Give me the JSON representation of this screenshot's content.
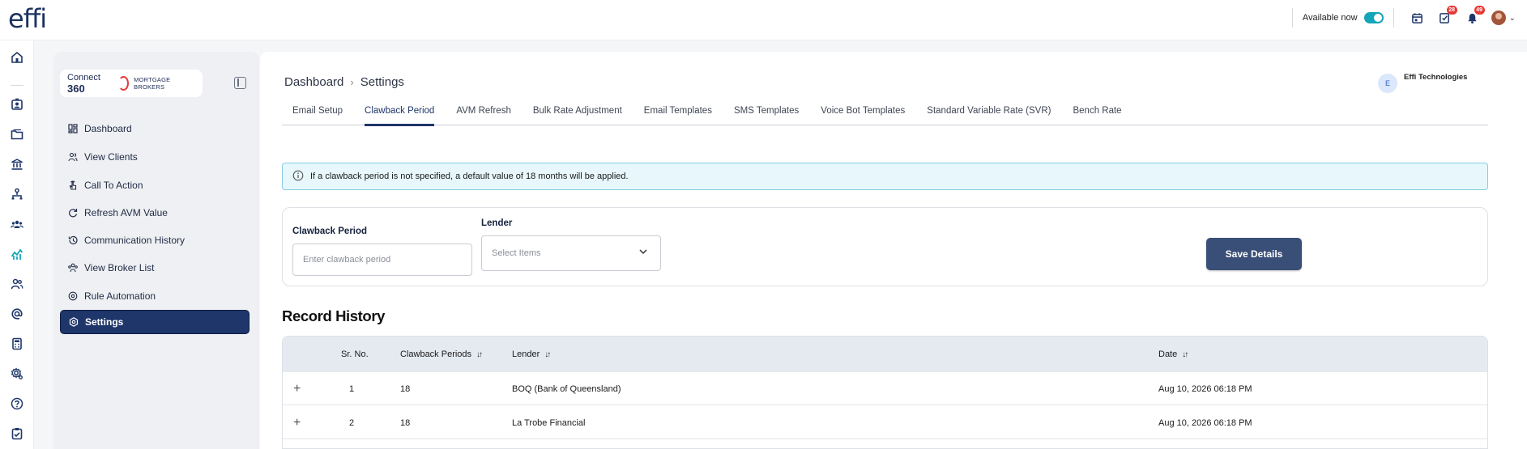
{
  "app": {
    "logo": "effi"
  },
  "topbar": {
    "available_label": "Available now",
    "available_on": true,
    "icons": [
      {
        "name": "calendar-icon",
        "badge": ""
      },
      {
        "name": "tasks-icon",
        "badge": "28"
      },
      {
        "name": "bell-icon",
        "badge": "49"
      }
    ]
  },
  "rail": {
    "icons": [
      "home-icon",
      "contact-card-icon",
      "folder-icon",
      "bank-icon",
      "org-chart-icon",
      "team-icon",
      "analytics-icon",
      "users-icon",
      "at-icon",
      "calculator-icon",
      "settings-gear-icon",
      "help-icon",
      "clipboard-icon"
    ]
  },
  "brand": {
    "name": "Connect",
    "number": "360",
    "tagline": "MORTGAGE BROKERS"
  },
  "sidebar": {
    "items": [
      {
        "label": "Dashboard",
        "icon": "dashboard-icon",
        "active": false
      },
      {
        "label": "View Clients",
        "icon": "clients-icon",
        "active": false
      },
      {
        "label": "Call To Action",
        "icon": "hand-pointer-icon",
        "active": false
      },
      {
        "label": "Refresh AVM Value",
        "icon": "refresh-icon",
        "active": false
      },
      {
        "label": "Communication History",
        "icon": "history-icon",
        "active": false
      },
      {
        "label": "View Broker List",
        "icon": "broker-list-icon",
        "active": false
      },
      {
        "label": "Rule Automation",
        "icon": "automation-icon",
        "active": false
      },
      {
        "label": "Settings",
        "icon": "settings-icon",
        "active": true
      }
    ]
  },
  "breadcrumb": {
    "root": "Dashboard",
    "current": "Settings"
  },
  "org": {
    "initial": "E",
    "name": "Effi Technologies"
  },
  "tabs": [
    {
      "label": "Email Setup",
      "active": false
    },
    {
      "label": "Clawback Period",
      "active": true
    },
    {
      "label": "AVM Refresh",
      "active": false
    },
    {
      "label": "Bulk Rate Adjustment",
      "active": false
    },
    {
      "label": "Email Templates",
      "active": false
    },
    {
      "label": "SMS Templates",
      "active": false
    },
    {
      "label": "Voice Bot Templates",
      "active": false
    },
    {
      "label": "Standard Variable Rate (SVR)",
      "active": false
    },
    {
      "label": "Bench Rate",
      "active": false
    }
  ],
  "info_message": "If a clawback period is not specified, a default value of 18 months will be applied.",
  "form": {
    "clawback_label": "Clawback Period",
    "clawback_placeholder": "Enter clawback period",
    "clawback_value": "",
    "lender_label": "Lender",
    "lender_placeholder": "Select Items",
    "save_label": "Save Details"
  },
  "history": {
    "title": "Record History",
    "columns": [
      "Sr. No.",
      "Clawback Periods",
      "Lender",
      "Date"
    ],
    "rows": [
      {
        "sr": "1",
        "period": "18",
        "lender": "BOQ (Bank of Queensland)",
        "date": "Aug 10, 2026 06:18 PM"
      },
      {
        "sr": "2",
        "period": "18",
        "lender": "La Trobe Financial",
        "date": "Aug 10, 2026 06:18 PM"
      }
    ]
  },
  "colors": {
    "primary": "#1e3669",
    "accent": "#12a6b8",
    "badge": "#e53935",
    "info_bg": "#e7f7fc"
  }
}
